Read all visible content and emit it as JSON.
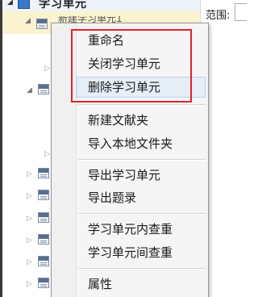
{
  "tree": {
    "header_title": "学习单元",
    "selected_item_label": "新建学习单元1"
  },
  "scope": {
    "label": "范围:"
  },
  "context_menu": {
    "items": [
      {
        "label": "重命名"
      },
      {
        "label": "关闭学习单元"
      },
      {
        "label": "删除学习单元"
      },
      {
        "label": "新建文献夹"
      },
      {
        "label": "导入本地文件夹"
      },
      {
        "label": "导出学习单元"
      },
      {
        "label": "导出题录"
      },
      {
        "label": "学习单元内查重"
      },
      {
        "label": "学习单元间查重"
      },
      {
        "label": "属性"
      }
    ],
    "hovered_item": "删除学习单元",
    "annotation_color": "#e0222c"
  }
}
